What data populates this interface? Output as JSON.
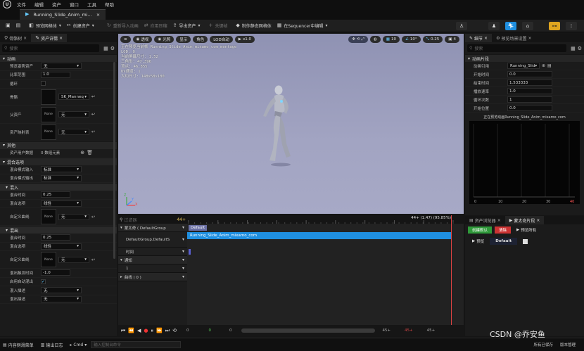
{
  "menu": {
    "logo": "U",
    "items": [
      "文件",
      "编辑",
      "资产",
      "窗口",
      "工具",
      "帮助"
    ]
  },
  "document_tab": {
    "title": "Running_Slide_Anim_mi...",
    "close": "×"
  },
  "toolbar": {
    "items": [
      {
        "label": "",
        "icon": "save-icon"
      },
      {
        "label": "",
        "icon": "browse-icon"
      },
      {
        "label": "预览网格体",
        "icon": "mesh-icon"
      },
      {
        "label": "创建资产",
        "icon": "create-asset-icon"
      },
      {
        "label": "重新导入动画",
        "icon": "reimport-icon"
      },
      {
        "label": "应用压缩",
        "icon": "compress-icon"
      },
      {
        "label": "导出资产",
        "icon": "export-icon"
      },
      {
        "label": "关键帧",
        "icon": "key-icon"
      },
      {
        "label": "制作静态网格体",
        "icon": "static-mesh-icon"
      },
      {
        "label": "在Sequencer中编辑",
        "icon": "sequencer-icon"
      }
    ],
    "mode_icons": [
      "skeleton-mode-icon",
      "mesh-mode-icon",
      "animation-mode-icon",
      "blueprint-mode-icon",
      "physics-mode-icon"
    ]
  },
  "left_panel": {
    "tabs": [
      "骨骼树",
      "资产详情"
    ],
    "search_placeholder": "搜索",
    "sections": [
      {
        "title": "动画",
        "rows": [
          {
            "label": "预览姿势资产",
            "type": "dropdown",
            "value": "无"
          },
          {
            "label": "比率范围",
            "type": "input",
            "value": "1.0"
          },
          {
            "label": "循环",
            "type": "checkbox",
            "checked": false
          },
          {
            "label": "骨骼",
            "type": "asset",
            "thumb": "",
            "value": "SK_Manneq"
          },
          {
            "label": "父资产",
            "type": "asset",
            "thumb": "None",
            "value": "无"
          },
          {
            "label": "资产映射表",
            "type": "asset",
            "thumb": "None",
            "value": "无"
          }
        ]
      },
      {
        "title": "其他",
        "rows": [
          {
            "label": "资产用户数据",
            "type": "text",
            "value": "0 数组元素"
          }
        ]
      },
      {
        "title": "混合选项",
        "rows": [
          {
            "label": "混合模式输入",
            "type": "dropdown",
            "value": "标准"
          },
          {
            "label": "混合模式输出",
            "type": "dropdown",
            "value": "标准"
          }
        ]
      },
      {
        "title": "混入",
        "sub": true,
        "rows": [
          {
            "label": "混合时间",
            "type": "input",
            "value": "0.25"
          },
          {
            "label": "混合选项",
            "type": "dropdown",
            "value": "线性"
          },
          {
            "label": "自定义曲线",
            "type": "asset",
            "thumb": "None",
            "value": "无"
          }
        ]
      },
      {
        "title": "混出",
        "sub": true,
        "rows": [
          {
            "label": "混合时间",
            "type": "input",
            "value": "0.25"
          },
          {
            "label": "混合选项",
            "type": "dropdown",
            "value": "线性"
          },
          {
            "label": "自定义曲线",
            "type": "asset",
            "thumb": "None",
            "value": "无"
          }
        ]
      },
      {
        "title": "",
        "rows": [
          {
            "label": "混出触发时间",
            "type": "input",
            "value": "-1.0"
          },
          {
            "label": "启用自动混出",
            "type": "checkbox",
            "checked": true
          },
          {
            "label": "混入描述",
            "type": "dropdown",
            "value": "无"
          },
          {
            "label": "混出描述",
            "type": "dropdown",
            "value": "无"
          }
        ]
      }
    ]
  },
  "viewport": {
    "buttons": [
      "透视",
      "光照",
      "显示",
      "角色",
      "LOD自动",
      "x1.0"
    ],
    "right_buttons": [
      "10",
      "10°",
      "0.25",
      "4"
    ],
    "stats": [
      "正在预览当前帧 Running_Slide_Anim_mixamo_com_montage",
      "LOD: 0",
      "当前屏幕尺寸: 1.52",
      "三角形: 47,396",
      "顶点: 46,855",
      "UV通道: 1",
      "大约尺寸: 148x58x180"
    ],
    "axis": [
      "X",
      "Y",
      "Z"
    ]
  },
  "timeline": {
    "search_placeholder": "过滤器",
    "frame_counter": "44+",
    "current_time": "44+ (1.47) (95.85%)",
    "tracks": [
      {
        "label": "蒙太奇 ( DefaultGroup",
        "indent": 0,
        "expand": "▾"
      },
      {
        "label": "DefaultGroup.DefaultS",
        "indent": 1,
        "expand": ""
      },
      {
        "label": "时间",
        "indent": 1,
        "expand": ""
      },
      {
        "label": "通知",
        "indent": 0,
        "expand": "▾"
      },
      {
        "label": "1",
        "indent": 1,
        "expand": ""
      },
      {
        "label": "曲线 ( 0 )",
        "indent": 0,
        "expand": "▸"
      }
    ],
    "slot_label": "Default",
    "clip_label": "Running_Slide_Anim_mixamo_com",
    "ruler": [
      "0",
      "5",
      "10",
      "15",
      "20",
      "25",
      "30",
      "35",
      "40",
      "44+"
    ],
    "footer": {
      "start": "0",
      "start_green": "0",
      "start2": "0",
      "end": "45+",
      "end_red": "45+",
      "end2": "45+"
    }
  },
  "right_panel": {
    "tabs": [
      "细节",
      "预览场景设置"
    ],
    "search_placeholder": "搜索",
    "section": "动画片段",
    "rows": [
      {
        "label": "动画引用",
        "type": "dropdown",
        "value": "Running_Slid"
      },
      {
        "label": "开始时间",
        "type": "input",
        "value": "0.0"
      },
      {
        "label": "结束时间",
        "type": "input",
        "value": "1.533333"
      },
      {
        "label": "播放速率",
        "type": "input",
        "value": "1.0"
      },
      {
        "label": "循环次数",
        "type": "input",
        "value": "1"
      },
      {
        "label": "开始位置",
        "type": "input",
        "value": "0.0"
      }
    ],
    "preview_caption": "正在预览动画Running_Slide_Anim_mixamo_com",
    "graph_ticks": [
      "0",
      "10",
      "20",
      "30",
      "40"
    ],
    "montage_tabs": [
      "资产浏览器",
      "蒙太奇片段"
    ],
    "montage_buttons": {
      "create": "创建默认",
      "clear": "清除",
      "preview_all": "预览所有"
    },
    "montage_row": {
      "preview": "预览",
      "default": "Default"
    }
  },
  "status": {
    "items": [
      "内容侧滑菜单",
      "输出日志",
      "Cmd"
    ],
    "cmd_placeholder": "输入控制台命令",
    "right": [
      "所有已保存",
      "版本管理"
    ],
    "watermark": "CSDN @乔安鱼"
  }
}
